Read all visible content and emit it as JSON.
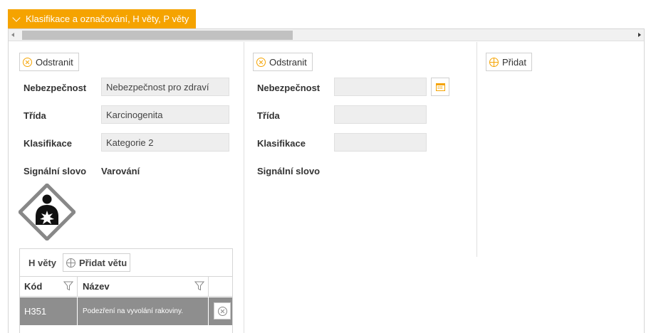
{
  "section": {
    "title": "Klasifikace a označování, H věty, P věty"
  },
  "column1": {
    "remove_label": "Odstranit",
    "hazard_label": "Nebezpečnost",
    "hazard_value": "Nebezpečnost pro zdraví",
    "class_label": "Třída",
    "class_value": "Karcinogenita",
    "category_label": "Klasifikace",
    "category_value": "Kategorie 2",
    "signal_label": "Signální slovo",
    "signal_value": "Varování",
    "pictogram_icon": "ghs08-health-hazard-icon",
    "h_phrases": {
      "title": "H věty",
      "add_label": "Přidat větu",
      "columns": [
        "Kód",
        "Název"
      ],
      "rows": [
        {
          "code": "H351",
          "name": "Podezření na vyvolání rakoviny."
        }
      ]
    }
  },
  "column2": {
    "remove_label": "Odstranit",
    "hazard_label": "Nebezpečnost",
    "hazard_value": "",
    "class_label": "Třída",
    "class_value": "",
    "category_label": "Klasifikace",
    "category_value": "",
    "signal_label": "Signální slovo"
  },
  "column3": {
    "add_label": "Přidat"
  },
  "colors": {
    "accent": "#f5a300",
    "selected_row": "#8e8e8e"
  }
}
